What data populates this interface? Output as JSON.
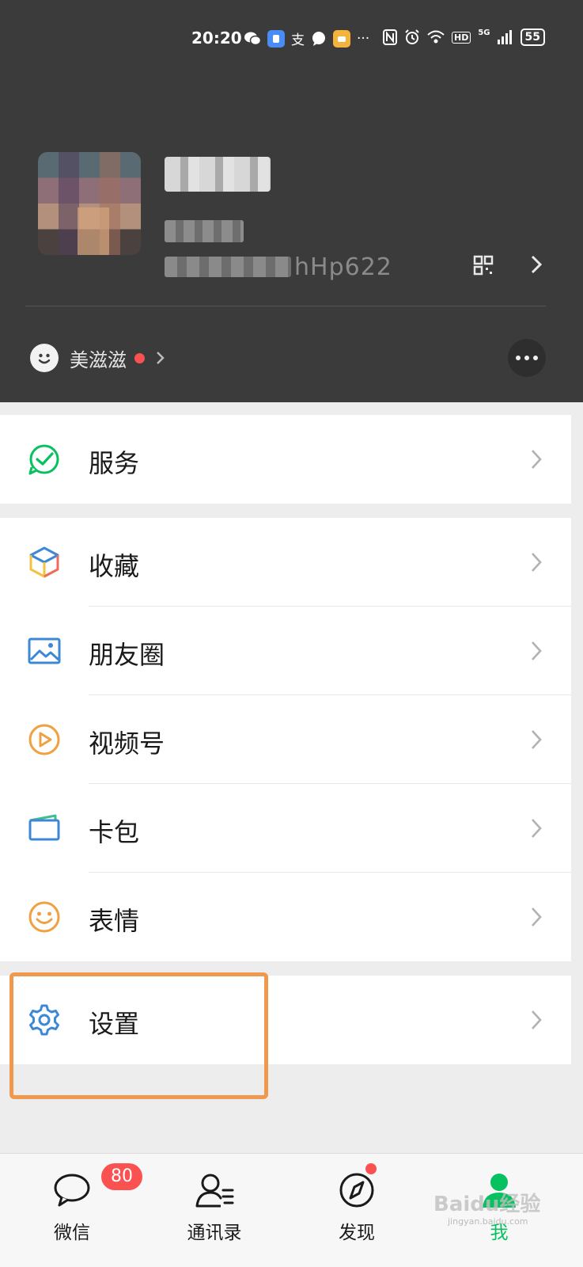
{
  "status_bar": {
    "time": "20:20",
    "alipay_glyph": "支",
    "more_glyph": "···",
    "network_label": "HD",
    "signal_label": "5G",
    "battery": "55"
  },
  "profile": {
    "wechat_id_suffix": "hHp622"
  },
  "status_row": {
    "text": "美滋滋"
  },
  "menu": {
    "services": "服务",
    "favorites": "收藏",
    "moments": "朋友圈",
    "channels": "视频号",
    "cards": "卡包",
    "stickers": "表情",
    "settings": "设置"
  },
  "tabbar": {
    "chats": "微信",
    "chats_badge": "80",
    "contacts": "通讯录",
    "discover": "发现",
    "me": "我"
  },
  "watermark": {
    "text": "Baidu经验",
    "sub": "jingyan.baidu.com"
  },
  "colors": {
    "header_bg": "#3b3b3b",
    "accent_green": "#07c160",
    "badge_red": "#fa5151",
    "highlight_orange": "#f0984d"
  }
}
